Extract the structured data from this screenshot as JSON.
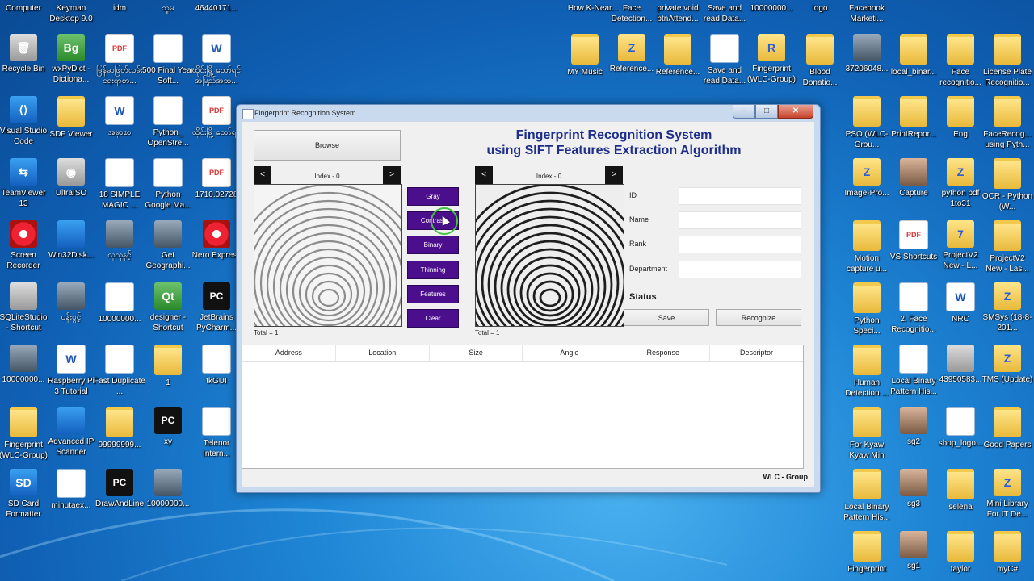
{
  "desktop": {
    "icons": [
      {
        "label": "Computer",
        "glyph": "",
        "type": "g-grey"
      },
      {
        "label": "Keyman Desktop 9.0",
        "glyph": "",
        "type": "g-blue"
      },
      {
        "label": "idm",
        "glyph": "",
        "type": "g-grey"
      },
      {
        "label": "သူမ",
        "glyph": "",
        "type": "g-img"
      },
      {
        "label": "46440171...",
        "glyph": "",
        "type": "g-img"
      },
      {
        "label": "Recycle Bin",
        "glyph": "🗑",
        "type": "g-grey"
      },
      {
        "label": "wxPyDict - Dictiona...",
        "glyph": "Bg",
        "type": "g-app"
      },
      {
        "label": "မြန်မာဖြတ်လမ်း ရေးရာစာ...",
        "glyph": "PDF",
        "type": "g-pdf"
      },
      {
        "label": "500 Final Year Soft...",
        "glyph": "",
        "type": "g-doc"
      },
      {
        "label": "ထိုင်းမြို့ တော်ရင် အမြည်အဆ...",
        "glyph": "W",
        "type": "g-doc"
      },
      {
        "label": "Visual Studio Code",
        "glyph": "⟨⟩",
        "type": "g-blue"
      },
      {
        "label": "SDF Viewer",
        "glyph": "",
        "type": "g-folder"
      },
      {
        "label": "အမှာစာ",
        "glyph": "W",
        "type": "g-doc"
      },
      {
        "label": "Python_ OpenStre...",
        "glyph": "",
        "type": "g-doc"
      },
      {
        "label": "ထိုင်းမြို့ တော်ရင်",
        "glyph": "PDF",
        "type": "g-pdf"
      },
      {
        "label": "TeamViewer 13",
        "glyph": "⇆",
        "type": "g-blue"
      },
      {
        "label": "UltraISO",
        "glyph": "◉",
        "type": "g-grey"
      },
      {
        "label": "18 SIMPLE MAGIC ...",
        "glyph": "",
        "type": "g-doc"
      },
      {
        "label": "Python Google Ma...",
        "glyph": "",
        "type": "g-doc"
      },
      {
        "label": "1710.02728",
        "glyph": "PDF",
        "type": "g-pdf"
      },
      {
        "label": "Screen Recorder",
        "glyph": "",
        "type": "g-red"
      },
      {
        "label": "Win32Disk...",
        "glyph": "",
        "type": "g-blue"
      },
      {
        "label": "လှလှနှင့်",
        "glyph": "",
        "type": "g-img"
      },
      {
        "label": "Get Geographi...",
        "glyph": "",
        "type": "g-img"
      },
      {
        "label": "Nero Express",
        "glyph": "",
        "type": "g-red"
      },
      {
        "label": "SQLiteStudio - Shortcut",
        "glyph": "",
        "type": "g-grey"
      },
      {
        "label": "ပန်းပွင့်",
        "glyph": "",
        "type": "g-img"
      },
      {
        "label": "10000000...",
        "glyph": "",
        "type": "g-doc"
      },
      {
        "label": "designer - Shortcut",
        "glyph": "Qt",
        "type": "g-app"
      },
      {
        "label": "JetBrains PyCharm...",
        "glyph": "PC",
        "type": "g-pc"
      },
      {
        "label": "10000000...",
        "glyph": "",
        "type": "g-img"
      },
      {
        "label": "Raspberry Pi 3 Tutorial",
        "glyph": "W",
        "type": "g-doc"
      },
      {
        "label": "Fast Duplicate ...",
        "glyph": "",
        "type": "g-doc"
      },
      {
        "label": "1",
        "glyph": "",
        "type": "g-folder"
      },
      {
        "label": "tkGUI",
        "glyph": "",
        "type": "g-doc"
      },
      {
        "label": "Fingerprint (WLC-Group)",
        "glyph": "",
        "type": "g-folder"
      },
      {
        "label": "Advanced IP Scanner",
        "glyph": "",
        "type": "g-blue"
      },
      {
        "label": "99999999...",
        "glyph": "",
        "type": "g-folder"
      },
      {
        "label": "xy",
        "glyph": "PC",
        "type": "g-pc"
      },
      {
        "label": "Telenor Intern...",
        "glyph": "",
        "type": "g-doc"
      },
      {
        "label": "SD Card Formatter",
        "glyph": "SD",
        "type": "g-blue"
      },
      {
        "label": "minutaex...",
        "glyph": "",
        "type": "g-doc"
      },
      {
        "label": "DrawAndLine",
        "glyph": "PC",
        "type": "g-pc"
      },
      {
        "label": "10000000...",
        "glyph": "",
        "type": "g-img"
      },
      {
        "label": "How K-Near...",
        "glyph": "",
        "type": "g-folder"
      },
      {
        "label": "Face Detection...",
        "glyph": "",
        "type": "g-folder"
      },
      {
        "label": "private void btnAttend...",
        "glyph": "",
        "type": "g-folder"
      },
      {
        "label": "Save and read Data...",
        "glyph": "",
        "type": "g-folder"
      },
      {
        "label": "10000000...",
        "glyph": "",
        "type": "g-folder"
      },
      {
        "label": "logo",
        "glyph": "",
        "type": "g-folder"
      },
      {
        "label": "Facebook Marketi...",
        "glyph": "",
        "type": "g-folder"
      },
      {
        "label": "MY Music",
        "glyph": "",
        "type": "g-folder"
      },
      {
        "label": "Reference...",
        "glyph": "Z",
        "type": "g-zfolder"
      },
      {
        "label": "Reference...",
        "glyph": "",
        "type": "g-folder"
      },
      {
        "label": "Save and read Data...",
        "glyph": "",
        "type": "g-doc"
      },
      {
        "label": "Fingerprint (WLC-Group)",
        "glyph": "R",
        "type": "g-zfolder"
      },
      {
        "label": "Blood Donatio...",
        "glyph": "",
        "type": "g-folder"
      },
      {
        "label": "37206048...",
        "glyph": "",
        "type": "g-img"
      },
      {
        "label": "local_binar...",
        "glyph": "",
        "type": "g-folder"
      },
      {
        "label": "Face recognitio...",
        "glyph": "",
        "type": "g-folder"
      },
      {
        "label": "License Plate Recognitio...",
        "glyph": "",
        "type": "g-folder"
      },
      {
        "label": "PSO (WLC-Grou...",
        "glyph": "",
        "type": "g-folder"
      },
      {
        "label": "PrintRepor...",
        "glyph": "",
        "type": "g-folder"
      },
      {
        "label": "Eng",
        "glyph": "",
        "type": "g-folder"
      },
      {
        "label": "FaceRecog... using Pyth...",
        "glyph": "",
        "type": "g-folder"
      },
      {
        "label": "Image-Pro...",
        "glyph": "Z",
        "type": "g-zfolder"
      },
      {
        "label": "Capture",
        "glyph": "",
        "type": "g-person"
      },
      {
        "label": "python pdf 1to31",
        "glyph": "Z",
        "type": "g-zfolder"
      },
      {
        "label": "OCR - Python (W...",
        "glyph": "",
        "type": "g-folder"
      },
      {
        "label": "Motion capture u...",
        "glyph": "",
        "type": "g-folder"
      },
      {
        "label": "VS Shortcuts",
        "glyph": "PDF",
        "type": "g-pdf"
      },
      {
        "label": "ProjectV2 New - L...",
        "glyph": "7",
        "type": "g-zfolder"
      },
      {
        "label": "ProjectV2 New - Las...",
        "glyph": "",
        "type": "g-folder"
      },
      {
        "label": "Python Speci...",
        "glyph": "",
        "type": "g-folder"
      },
      {
        "label": "2. Face Recognitio...",
        "glyph": "",
        "type": "g-doc"
      },
      {
        "label": "NRC",
        "glyph": "W",
        "type": "g-doc"
      },
      {
        "label": "SMSys (18-8-201...",
        "glyph": "Z",
        "type": "g-zfolder"
      },
      {
        "label": "Human Detection ...",
        "glyph": "",
        "type": "g-folder"
      },
      {
        "label": "Local Binary Pattern His...",
        "glyph": "",
        "type": "g-doc"
      },
      {
        "label": "43950583...",
        "glyph": "",
        "type": "g-grey"
      },
      {
        "label": "TMS (Update)",
        "glyph": "Z",
        "type": "g-zfolder"
      },
      {
        "label": "For Kyaw Kyaw Min",
        "glyph": "",
        "type": "g-folder"
      },
      {
        "label": "sg2",
        "glyph": "",
        "type": "g-person"
      },
      {
        "label": "shop_logo...",
        "glyph": "",
        "type": "g-doc"
      },
      {
        "label": "Good Papers",
        "glyph": "",
        "type": "g-folder"
      },
      {
        "label": "Local Binary Pattern His...",
        "glyph": "",
        "type": "g-folder"
      },
      {
        "label": "sg3",
        "glyph": "",
        "type": "g-person"
      },
      {
        "label": "selena",
        "glyph": "",
        "type": "g-folder"
      },
      {
        "label": "Mini Library For IT De...",
        "glyph": "Z",
        "type": "g-zfolder"
      },
      {
        "label": "Fingerprint",
        "glyph": "",
        "type": "g-folder"
      },
      {
        "label": "sg1",
        "glyph": "",
        "type": "g-person"
      },
      {
        "label": "taylor",
        "glyph": "",
        "type": "g-folder"
      },
      {
        "label": "myC#",
        "glyph": "",
        "type": "g-folder"
      }
    ]
  },
  "window": {
    "title": "Fingerprint Recognition System",
    "controls": {
      "minimize": "–",
      "maximize": "□",
      "close": "✕"
    }
  },
  "app": {
    "browse_label": "Browse",
    "title_line1": "Fingerprint Recognition System",
    "title_line2": "using SIFT Features Extraction Algorithm",
    "left_panel": {
      "prev": "<",
      "next": ">",
      "index_label": "Index - 0",
      "total_label": "Total = 1"
    },
    "right_panel": {
      "prev": "<",
      "next": ">",
      "index_label": "Index - 0",
      "total_label": "Total = 1"
    },
    "process_buttons": [
      "Gray",
      "Contrast",
      "Binary",
      "Thinning",
      "Features",
      "Clear"
    ],
    "fields": [
      {
        "label": "ID",
        "value": ""
      },
      {
        "label": "Name",
        "value": ""
      },
      {
        "label": "Rank",
        "value": ""
      },
      {
        "label": "Department",
        "value": ""
      }
    ],
    "status_label": "Status",
    "save_label": "Save",
    "recognize_label": "Recognize",
    "table_headers": [
      "Address",
      "Location",
      "Size",
      "Angle",
      "Response",
      "Descriptor"
    ],
    "footer": "WLC - Group"
  },
  "colors": {
    "title_blue": "#1e2e8a",
    "process_button_purple": "#4b0f8d"
  }
}
